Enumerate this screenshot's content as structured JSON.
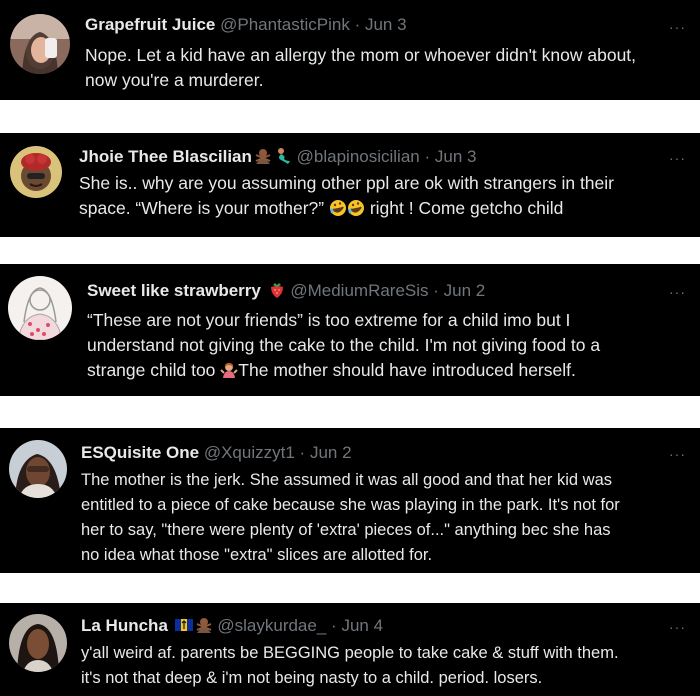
{
  "tweets": [
    {
      "name": "Grapefruit Juice",
      "handle": "@PhantasticPink",
      "sep": "·",
      "time": "Jun 3",
      "more": "···",
      "lines": [
        "Nope. Let a kid have an allergy the mom or whoever didn't know about,",
        "now you're a murderer."
      ]
    },
    {
      "name": "Jhoie Thee Blascilian",
      "name_emojis": [
        "person-gesturing-no-emoji",
        "mermaid-emoji"
      ],
      "handle": "@blapinosicilian",
      "sep": "·",
      "time": "Jun 3",
      "more": "···",
      "lines": [
        "She is.. why are you assuming other ppl are ok with strangers in their",
        "space. “Where is your mother?”",
        " right ! Come getcho child"
      ],
      "inline_emojis": [
        "rofl-emoji",
        "rofl-emoji"
      ]
    },
    {
      "name": "Sweet like strawberry",
      "name_emojis": [
        "strawberry-emoji"
      ],
      "handle": "@MediumRareSis",
      "sep": "·",
      "time": "Jun 2",
      "more": "···",
      "lines": [
        "“These are not your friends” is too extreme for a child imo but I",
        "understand not giving the cake to the child. I'm not giving food to a",
        "strange child too",
        "The mother should have introduced herself."
      ],
      "inline_emojis": [
        "person-shrugging-emoji"
      ]
    },
    {
      "name": "ESQuisite One",
      "handle": "@Xquizzyt1",
      "sep": "·",
      "time": "Jun 2",
      "more": "···",
      "lines": [
        "The mother is the jerk. She assumed it was all good and that her kid was",
        "entitled to a piece of cake because she was playing in the park. It's not for",
        "her to say, \"there were plenty of 'extra' pieces of...\" anything bec she has",
        "no idea what those \"extra\" slices are allotted for."
      ]
    },
    {
      "name": "La Huncha",
      "name_emojis": [
        "barbados-flag-emoji",
        "person-gesturing-no-emoji"
      ],
      "handle": "@slaykurdae_",
      "sep": "·",
      "time": "Jun 4",
      "more": "···",
      "lines": [
        "y'all weird af. parents be BEGGING people to take cake & stuff with them.",
        "it's not that deep & i'm not being nasty to a child. period. losers."
      ]
    }
  ],
  "colors": {
    "background": "#000000",
    "text": "#e7e9ea",
    "muted": "#71767b"
  }
}
